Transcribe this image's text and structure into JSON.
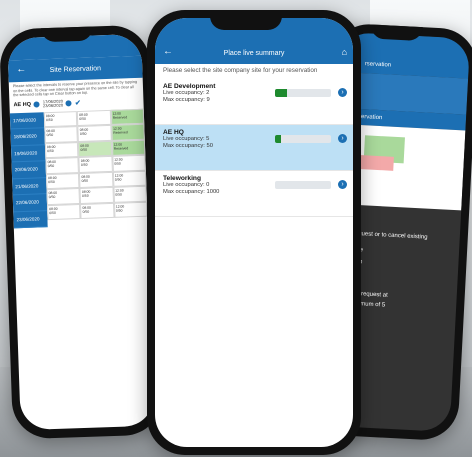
{
  "center": {
    "title": "Place live summary",
    "instruction": "Please select the site company site for your reservation",
    "sites": [
      {
        "name": "AE Development",
        "live_label": "Live occupancy: 2",
        "max_label": "Max occupancy: 9",
        "occupancy": 0.22,
        "selected": false
      },
      {
        "name": "AE HQ",
        "live_label": "Live occupancy: 5",
        "max_label": "Max occupancy: 50",
        "occupancy": 0.1,
        "selected": true
      },
      {
        "name": "Teleworking",
        "live_label": "Live occupancy: 0",
        "max_label": "Max occupancy: 1000",
        "occupancy": 0.0,
        "selected": false
      }
    ]
  },
  "left": {
    "title": "Site Reservation",
    "instruction": "Please select the intervals to reserve your presence on the site by tapping on the cells. To clear one interval tap again on the same cell. To clear all the selected cells tap on Clear button on top.",
    "site": "AE HQ",
    "date_from": "17/06/2020",
    "date_to": "23/06/2020",
    "dates": [
      "17/06/2020",
      "18/06/2020",
      "19/06/2020",
      "20/06/2020",
      "21/06/2020",
      "22/06/2020",
      "23/06/2020"
    ],
    "time_headers": [
      "08:00",
      "08:00",
      "12:00"
    ],
    "cell_value": "0/50",
    "reserved_label": "Reserved"
  },
  "right": {
    "title": "rservation",
    "subtitle": "servation",
    "overlay_lines": [
      "a request or to cancel existing",
      "vigate",
      "ection",
      "make request at",
      "f maximum of 5"
    ]
  },
  "colors": {
    "accent": "#1c6fb3",
    "selected": "#bde0f5",
    "occupancy": "#1e8a2e"
  }
}
